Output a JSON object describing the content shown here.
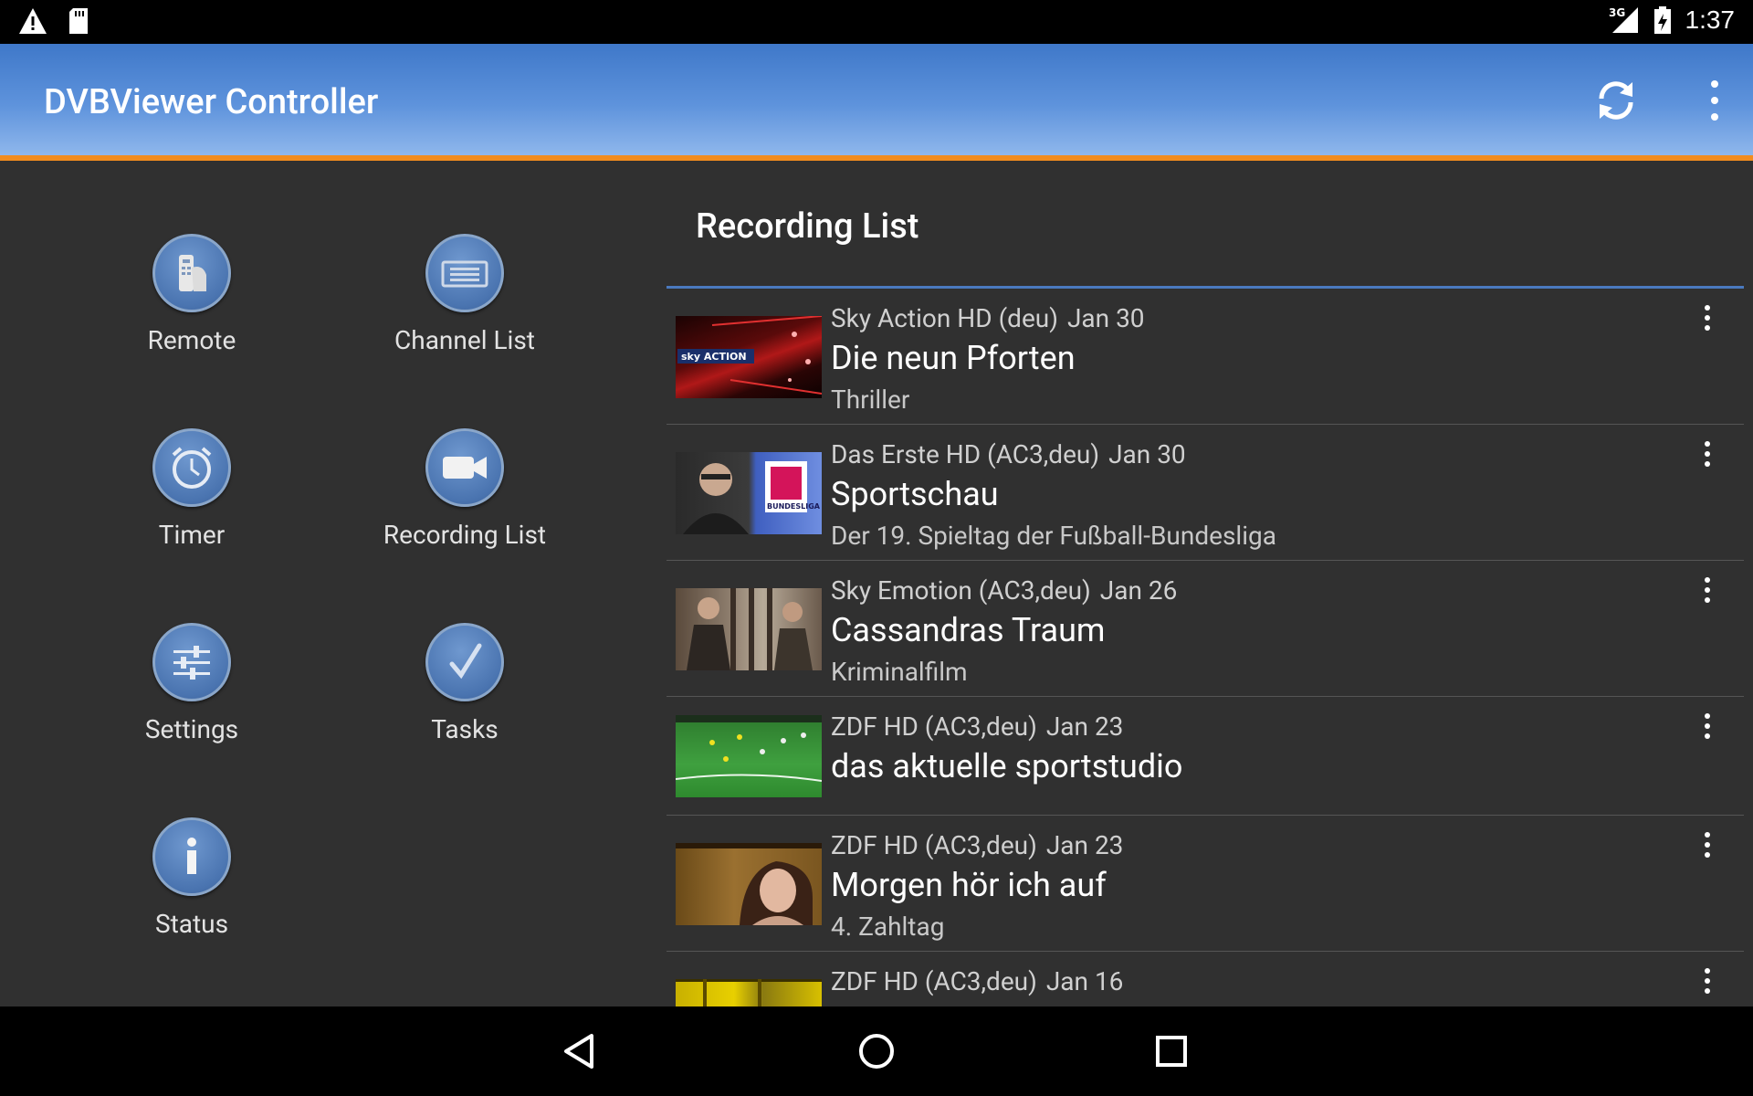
{
  "status_bar": {
    "time": "1:37",
    "network": "3G"
  },
  "app_bar": {
    "title": "DVBViewer Controller"
  },
  "nav": [
    {
      "label": "Remote",
      "icon": "remote-icon"
    },
    {
      "label": "Channel List",
      "icon": "channel-list-icon"
    },
    {
      "label": "Timer",
      "icon": "clock-icon"
    },
    {
      "label": "Recording List",
      "icon": "video-camera-icon"
    },
    {
      "label": "Settings",
      "icon": "sliders-icon"
    },
    {
      "label": "Tasks",
      "icon": "checkmark-icon"
    },
    {
      "label": "Status",
      "icon": "info-icon"
    }
  ],
  "recording_list": {
    "title": "Recording List",
    "items": [
      {
        "channel": "Sky Action HD (deu)",
        "date": "Jan 30",
        "title": "Die neun Pforten",
        "subtitle": "Thriller",
        "thumb_logo": "sky ACTION"
      },
      {
        "channel": "Das Erste HD (AC3,deu)",
        "date": "Jan 30",
        "title": "Sportschau",
        "subtitle": "Der 19. Spieltag der Fußball-Bundesliga",
        "thumb_logo": "BUNDESLIGA"
      },
      {
        "channel": "Sky Emotion (AC3,deu)",
        "date": "Jan 26",
        "title": "Cassandras Traum",
        "subtitle": "Kriminalfilm"
      },
      {
        "channel": "ZDF HD (AC3,deu)",
        "date": "Jan 23",
        "title": "das aktuelle sportstudio",
        "subtitle": ""
      },
      {
        "channel": "ZDF HD (AC3,deu)",
        "date": "Jan 23",
        "title": "Morgen hör ich auf",
        "subtitle": "4. Zahltag"
      },
      {
        "channel": "ZDF HD (AC3,deu)",
        "date": "Jan 16",
        "title": "",
        "subtitle": ""
      }
    ]
  }
}
